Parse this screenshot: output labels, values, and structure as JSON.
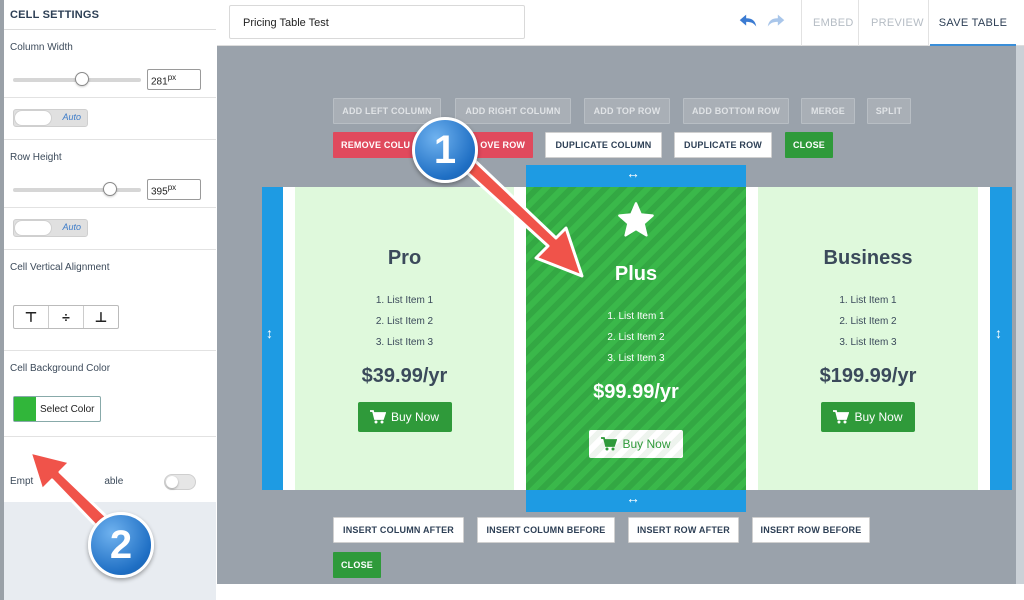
{
  "sidebar": {
    "title": "CELL SETTINGS",
    "column_width": {
      "label": "Column Width",
      "value": "281",
      "unit": "px",
      "slider_fraction": 0.52
    },
    "column_auto": "Auto",
    "row_height": {
      "label": "Row Height",
      "value": "395",
      "unit": "px",
      "slider_fraction": 0.77
    },
    "row_auto": "Auto",
    "vertical_alignment": {
      "label": "Cell Vertical Alignment",
      "options": [
        "⊤",
        "÷",
        "⊥"
      ]
    },
    "background_color": {
      "label": "Cell Background Color",
      "button_label": "Select Color",
      "swatch": "#31b63a"
    },
    "empty_cell": {
      "label": "Empty Cell Enable",
      "label_visible_start": "Empt",
      "label_visible_end": "able"
    }
  },
  "topbar": {
    "table_name": "Pricing Table Test",
    "embed": "EMBED",
    "preview": "PREVIEW",
    "save": "SAVE TABLE"
  },
  "toolbar_top": {
    "add_left_column": "ADD LEFT COLUMN",
    "add_right_column": "ADD RIGHT COLUMN",
    "add_top_row": "ADD TOP ROW",
    "add_bottom_row": "ADD BOTTOM ROW",
    "merge": "MERGE",
    "split": "SPLIT",
    "remove_column_visible": "REMOVE COLU",
    "remove_row_visible": "OVE ROW",
    "duplicate_column": "DUPLICATE COLUMN",
    "duplicate_row": "DUPLICATE ROW",
    "close": "CLOSE"
  },
  "toolbar_bottom": {
    "insert_column_after": "INSERT COLUMN AFTER",
    "insert_column_before": "INSERT COLUMN BEFORE",
    "insert_row_after": "INSERT ROW AFTER",
    "insert_row_before": "INSERT ROW BEFORE",
    "close": "CLOSE"
  },
  "plans": [
    {
      "name": "Pro",
      "items": [
        "1. List Item 1",
        "2. List Item 2",
        "3. List Item 3"
      ],
      "price": "$39.99/yr",
      "button": "Buy Now"
    },
    {
      "name": "Plus",
      "items": [
        "1. List Item 1",
        "2. List Item 2",
        "3. List Item 3"
      ],
      "price": "$99.99/yr",
      "button": "Buy Now"
    },
    {
      "name": "Business",
      "items": [
        "1. List Item 1",
        "2. List Item 2",
        "3. List Item 3"
      ],
      "price": "$199.99/yr",
      "button": "Buy Now"
    }
  ],
  "annotations": {
    "step1": "1",
    "step2": "2"
  },
  "colors": {
    "accent_blue": "#1e9be3",
    "green": "#2f9a3a",
    "red_button": "#e04a5d",
    "annotation_arrow": "#f0534a"
  }
}
